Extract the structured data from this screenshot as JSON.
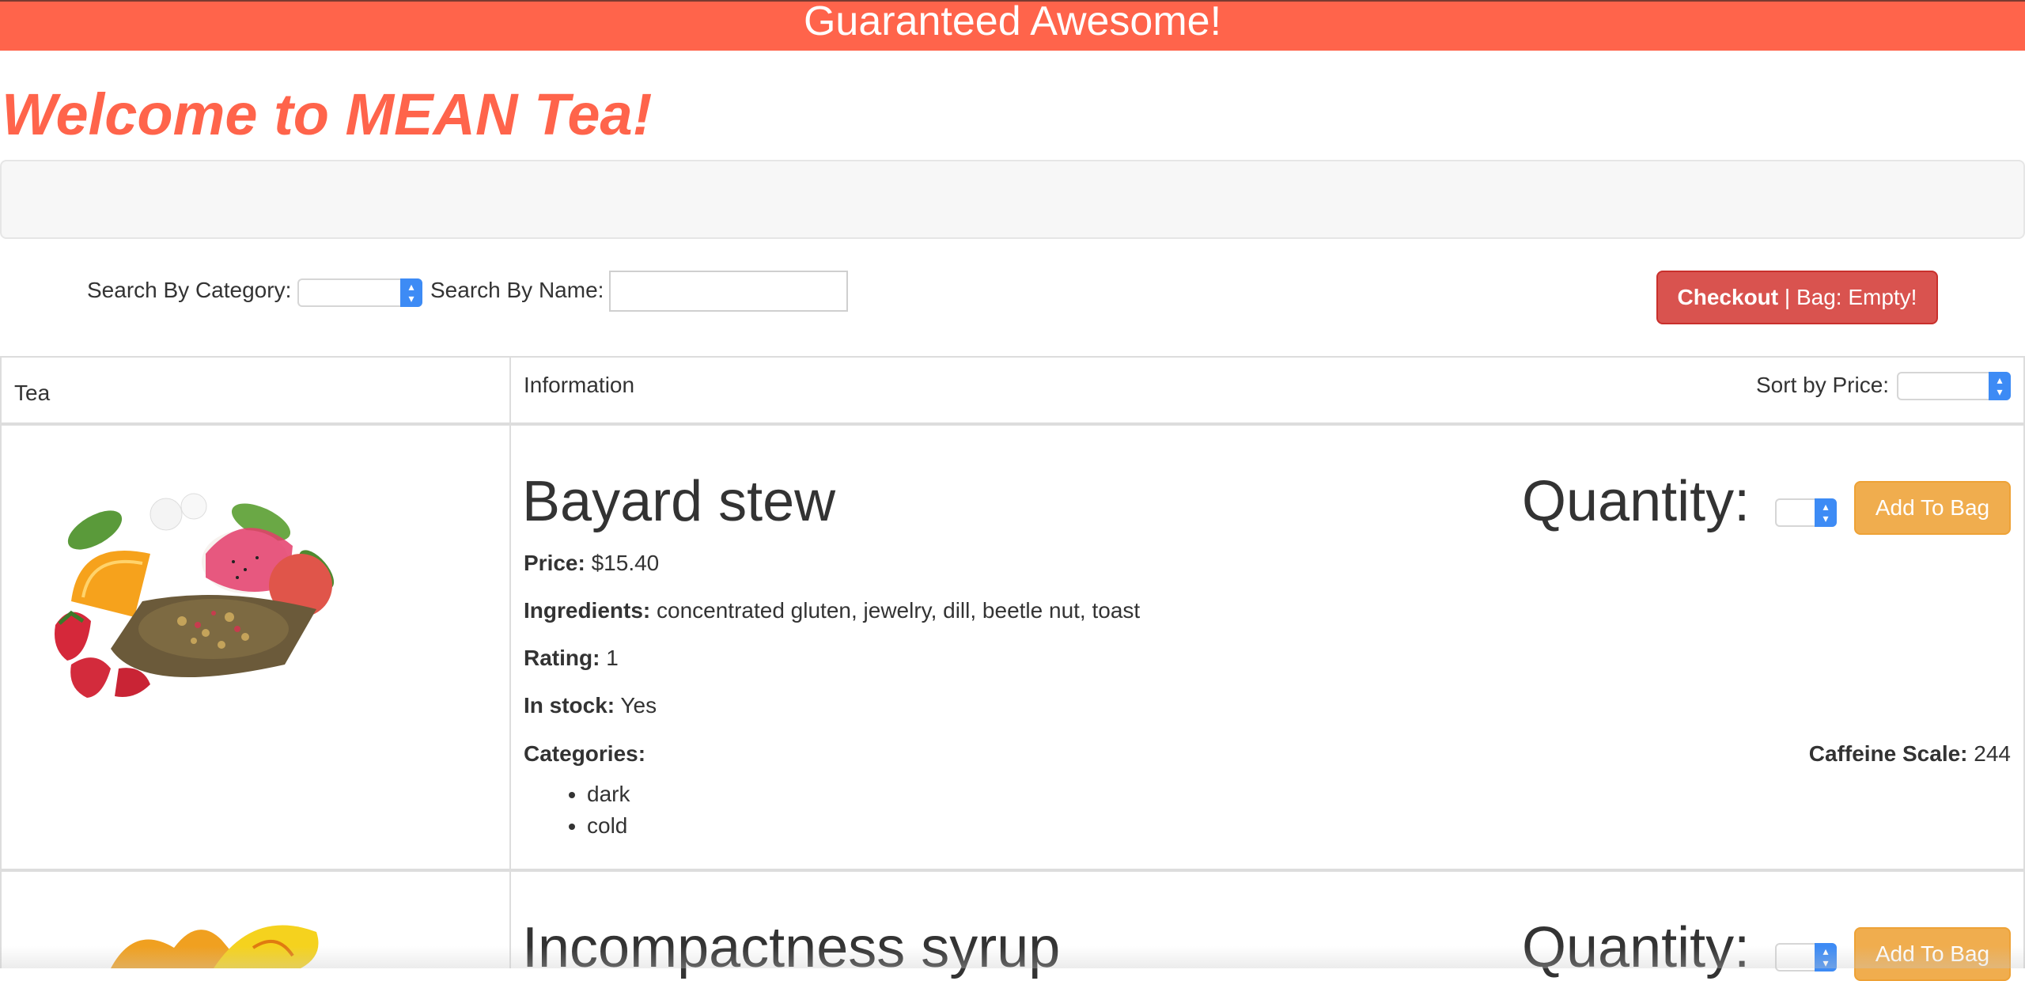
{
  "banner": {
    "text": "Guaranteed Awesome!"
  },
  "header": {
    "title": "Welcome to MEAN Tea!"
  },
  "filters": {
    "category_label": "Search By Category:",
    "category_value": "",
    "name_label": "Search By Name:",
    "name_value": "",
    "name_placeholder": ""
  },
  "checkout": {
    "bold": "Checkout",
    "rest": " | Bag: Empty!"
  },
  "table": {
    "headers": {
      "tea": "Tea",
      "information": "Information",
      "sort_label": "Sort by Price:"
    },
    "sort_value": ""
  },
  "labels": {
    "quantity": "Quantity:",
    "add": "Add To Bag",
    "price": "Price:",
    "ingredients": "Ingredients:",
    "rating": "Rating:",
    "in_stock": "In stock:",
    "categories": "Categories:",
    "caffeine": "Caffeine Scale:"
  },
  "teas": [
    {
      "name": "Bayard stew",
      "price": "$15.40",
      "ingredients": "concentrated gluten, jewelry, dill, beetle nut, toast",
      "rating": "1",
      "in_stock": "Yes",
      "categories": [
        "dark",
        "cold"
      ],
      "caffeine": "244"
    },
    {
      "name": "Incompactness syrup"
    }
  ],
  "colors": {
    "brand": "#ff644b",
    "checkout": "#d9534f",
    "add": "#f0ad4e",
    "select_arrows": "#3d8bf5"
  },
  "icons": {
    "select_arrows": "select-arrows-icon",
    "bullet": "bullet-icon"
  }
}
